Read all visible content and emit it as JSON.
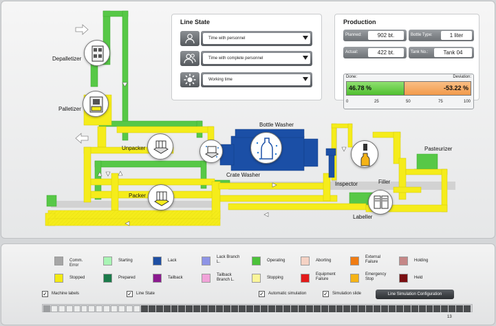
{
  "plant": {
    "labels": {
      "depalletizer": "Depalletizer",
      "palletizer": "Palletizer",
      "unpacker": "Unpacker",
      "crate_washer": "Crate Washer",
      "bottle_washer": "Bottle Washer",
      "packer": "Packer",
      "inspector": "Inspector",
      "filler": "Filler",
      "pasteurizer": "Pasteurizer",
      "labeller": "Labeller"
    },
    "colors": {
      "yellow": "#f5ec1b",
      "green": "#57c847",
      "blue": "#1b4fa6",
      "gray": "#cfcfcf"
    }
  },
  "line_state": {
    "title": "Line State",
    "rows": [
      {
        "icon": "person-icon",
        "value": "Time with personnel"
      },
      {
        "icon": "persons-icon",
        "value": "Time with complete personnel"
      },
      {
        "icon": "sun-icon",
        "value": "Working time"
      }
    ]
  },
  "production": {
    "title": "Production",
    "planned_label": "Planned:",
    "planned_value": "902 bt.",
    "bottle_type_label": "Bottle Type:",
    "bottle_type_value": "1 liter",
    "actual_label": "Actual:",
    "actual_value": "422 bt.",
    "tank_label": "Tank No.:",
    "tank_value": "Tank 04",
    "done_label": "Done:",
    "deviation_label": "Deviation:",
    "done_value": "46.78 %",
    "deviation_value": "-53.22 %",
    "done_fraction": 0.4678,
    "ticks": [
      "0",
      "25",
      "50",
      "75",
      "100"
    ]
  },
  "legend": [
    {
      "label": "Comm. Error",
      "color": "#a6a6a6"
    },
    {
      "label": "Starting",
      "color": "#a9f5b5"
    },
    {
      "label": "Lack",
      "color": "#1f4fa3"
    },
    {
      "label": "Lack Branch L.",
      "color": "#8e94e6"
    },
    {
      "label": "Operating",
      "color": "#4cc23a"
    },
    {
      "label": "Aborting",
      "color": "#f5d2c4"
    },
    {
      "label": "External Failure",
      "color": "#f07c13"
    },
    {
      "label": "Holding",
      "color": "#c58787"
    },
    {
      "label": "Stopped",
      "color": "#f3ea12"
    },
    {
      "label": "Prepared",
      "color": "#1b7a4a"
    },
    {
      "label": "Tailback",
      "color": "#8b1a8f"
    },
    {
      "label": "Tailback Branch L.",
      "color": "#f1a3d9"
    },
    {
      "label": "Stopping",
      "color": "#fbf59a"
    },
    {
      "label": "Equipment Failure",
      "color": "#e21a1a"
    },
    {
      "label": "Emergency Stop",
      "color": "#f5b316"
    },
    {
      "label": "Held",
      "color": "#7a0f12"
    }
  ],
  "options": {
    "machine_labels": "Machine labels",
    "line_state": "Line State",
    "automatic_simulation": "Automatic simulation",
    "simulation_slide": "Simulation slide",
    "config_button": "Line Simulation Configuration"
  },
  "simulation": {
    "position": 13,
    "total": 57,
    "page_number": "13"
  }
}
